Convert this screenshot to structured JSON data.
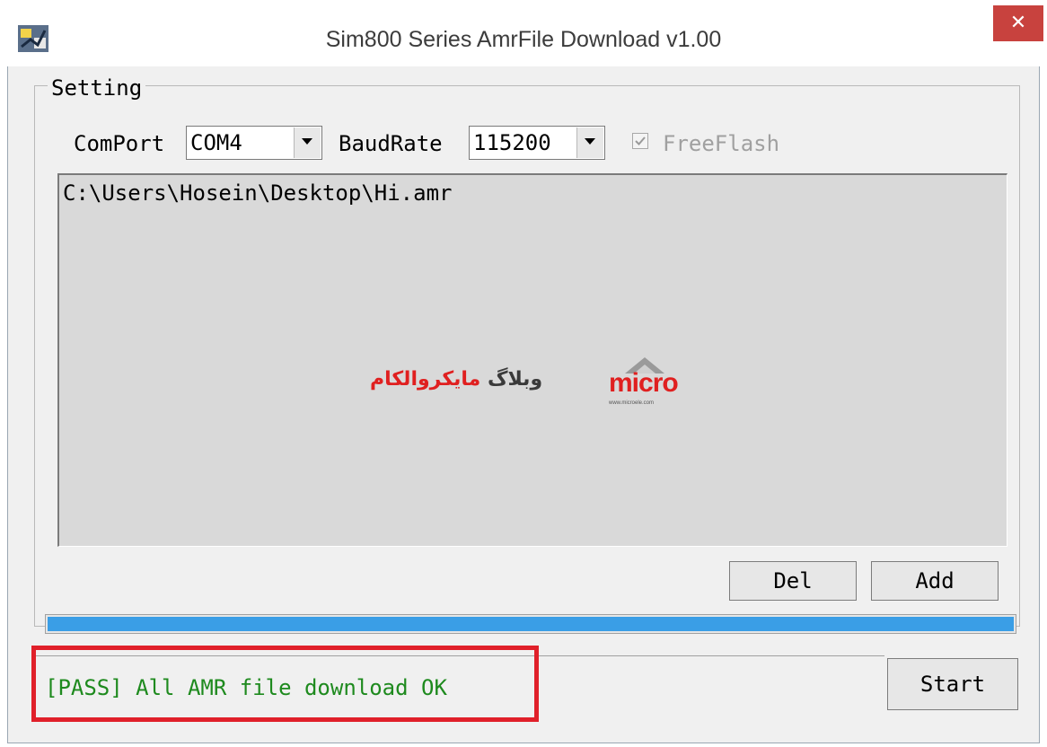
{
  "window": {
    "title": "Sim800 Series AmrFile Download v1.00",
    "close_glyph": "✕",
    "app_icon": "app-icon"
  },
  "settings": {
    "group_label": "Setting",
    "comport_label": "ComPort",
    "comport_value": "COM4",
    "baudrate_label": "BaudRate",
    "baudrate_value": "115200",
    "freeflash_label": "FreeFlash",
    "freeflash_checked": true
  },
  "file_list": {
    "items": [
      "C:\\Users\\Hosein\\Desktop\\Hi.amr"
    ]
  },
  "watermark": {
    "persian_red": "مایکروالکام",
    "persian_dark": "وبلاگ",
    "brand": "micro",
    "url": "www.microele.com"
  },
  "buttons": {
    "del_label": "Del",
    "add_label": "Add",
    "start_label": "Start"
  },
  "progress": {
    "fraction": 1.0,
    "color": "#3a9ee6"
  },
  "status": {
    "text": "[PASS] All AMR file download OK",
    "color": "#1e8a1e",
    "highlight_color": "#e0202a"
  }
}
